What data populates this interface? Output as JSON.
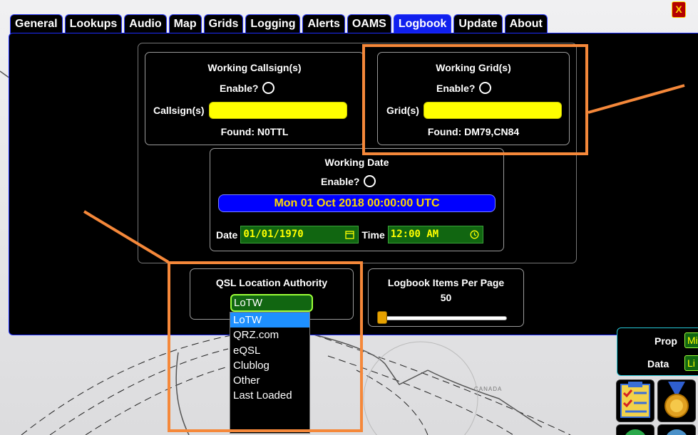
{
  "tabs": [
    {
      "label": "General"
    },
    {
      "label": "Lookups"
    },
    {
      "label": "Audio"
    },
    {
      "label": "Map"
    },
    {
      "label": "Grids"
    },
    {
      "label": "Logging"
    },
    {
      "label": "Alerts"
    },
    {
      "label": "OAMS"
    },
    {
      "label": "Logbook"
    },
    {
      "label": "Update"
    },
    {
      "label": "About"
    }
  ],
  "close_label": "X",
  "callsign_box": {
    "title": "Working Callsign(s)",
    "enable_label": "Enable?",
    "field_label": "Callsign(s)",
    "field_value": "",
    "found": "Found: N0TTL"
  },
  "grid_box": {
    "title": "Working Grid(s)",
    "enable_label": "Enable?",
    "field_label": "Grid(s)",
    "field_value": "",
    "found": "Found: DM79,CN84"
  },
  "date_box": {
    "title": "Working Date",
    "enable_label": "Enable?",
    "banner": "Mon 01 Oct 2018 00:00:00 UTC",
    "date_label": "Date",
    "date_value": "01/01/1970",
    "time_label": "Time",
    "time_value": "12:00 AM"
  },
  "qsl_box": {
    "title": "QSL Location Authority",
    "selected": "LoTW",
    "options": [
      "LoTW",
      "QRZ.com",
      "eQSL",
      "Clublog",
      "Other",
      "Last Loaded"
    ]
  },
  "per_page_box": {
    "title": "Logbook Items Per Page",
    "value": "50"
  },
  "side_panel": {
    "prop_label": "Prop",
    "prop_value": "Mi",
    "data_label": "Data",
    "data_value": "Li"
  },
  "map_label": "CANADA",
  "colors": {
    "tab_active": "#1020ee",
    "annotation": "#f5883a",
    "input_yellow": "#ffff00",
    "input_green": "#116611",
    "banner_blue": "#0000ff"
  }
}
